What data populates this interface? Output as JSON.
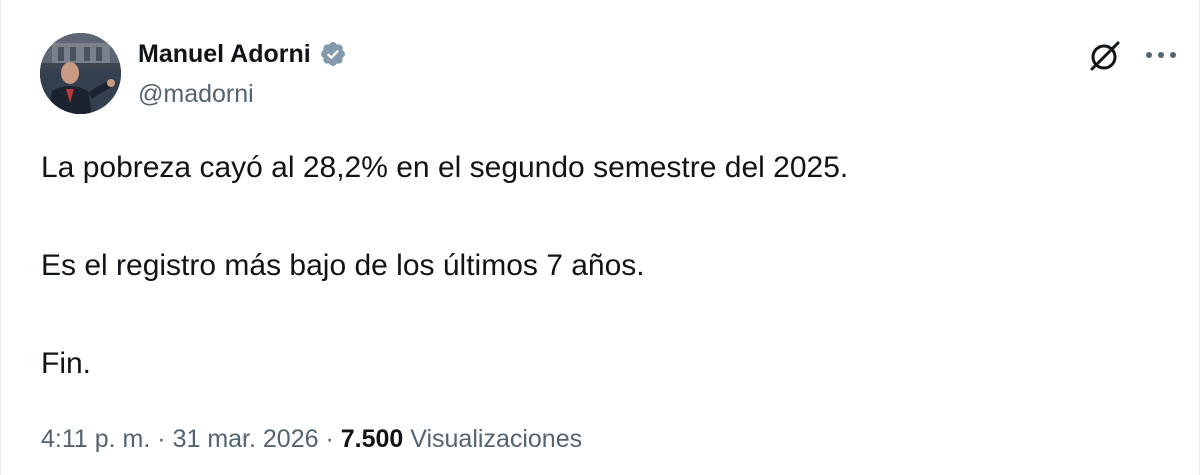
{
  "author": {
    "display_name": "Manuel Adorni",
    "handle": "@madorni",
    "verified": true,
    "verified_color": "#829aab"
  },
  "header_icons": {
    "grok": "grok-icon",
    "more": "more-options-icon"
  },
  "tweet": {
    "paragraphs": [
      "La pobreza cayó al 28,2% en el segundo semestre del 2025.",
      "Es el registro más bajo de los últimos 7 años.",
      "Fin."
    ]
  },
  "meta": {
    "time": "4:11 p. m.",
    "separator": "·",
    "date": "31 mar. 2026",
    "views_count": "7.500",
    "views_label": "Visualizaciones"
  },
  "colors": {
    "text_primary": "#0f1419",
    "text_secondary": "#536471"
  }
}
